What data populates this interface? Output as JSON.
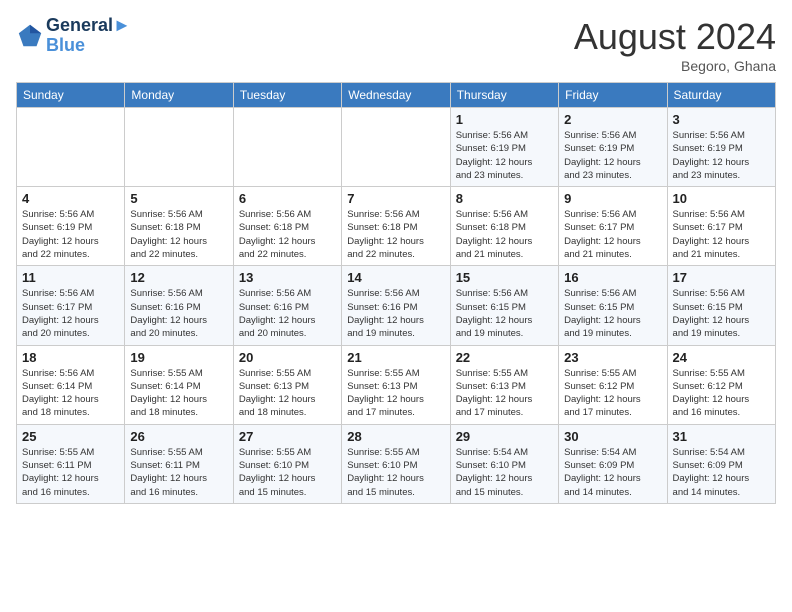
{
  "header": {
    "logo_line1": "General",
    "logo_line2": "Blue",
    "month_year": "August 2024",
    "location": "Begoro, Ghana"
  },
  "days_of_week": [
    "Sunday",
    "Monday",
    "Tuesday",
    "Wednesday",
    "Thursday",
    "Friday",
    "Saturday"
  ],
  "weeks": [
    [
      {
        "day": "",
        "info": ""
      },
      {
        "day": "",
        "info": ""
      },
      {
        "day": "",
        "info": ""
      },
      {
        "day": "",
        "info": ""
      },
      {
        "day": "1",
        "info": "Sunrise: 5:56 AM\nSunset: 6:19 PM\nDaylight: 12 hours\nand 23 minutes."
      },
      {
        "day": "2",
        "info": "Sunrise: 5:56 AM\nSunset: 6:19 PM\nDaylight: 12 hours\nand 23 minutes."
      },
      {
        "day": "3",
        "info": "Sunrise: 5:56 AM\nSunset: 6:19 PM\nDaylight: 12 hours\nand 23 minutes."
      }
    ],
    [
      {
        "day": "4",
        "info": "Sunrise: 5:56 AM\nSunset: 6:19 PM\nDaylight: 12 hours\nand 22 minutes."
      },
      {
        "day": "5",
        "info": "Sunrise: 5:56 AM\nSunset: 6:18 PM\nDaylight: 12 hours\nand 22 minutes."
      },
      {
        "day": "6",
        "info": "Sunrise: 5:56 AM\nSunset: 6:18 PM\nDaylight: 12 hours\nand 22 minutes."
      },
      {
        "day": "7",
        "info": "Sunrise: 5:56 AM\nSunset: 6:18 PM\nDaylight: 12 hours\nand 22 minutes."
      },
      {
        "day": "8",
        "info": "Sunrise: 5:56 AM\nSunset: 6:18 PM\nDaylight: 12 hours\nand 21 minutes."
      },
      {
        "day": "9",
        "info": "Sunrise: 5:56 AM\nSunset: 6:17 PM\nDaylight: 12 hours\nand 21 minutes."
      },
      {
        "day": "10",
        "info": "Sunrise: 5:56 AM\nSunset: 6:17 PM\nDaylight: 12 hours\nand 21 minutes."
      }
    ],
    [
      {
        "day": "11",
        "info": "Sunrise: 5:56 AM\nSunset: 6:17 PM\nDaylight: 12 hours\nand 20 minutes."
      },
      {
        "day": "12",
        "info": "Sunrise: 5:56 AM\nSunset: 6:16 PM\nDaylight: 12 hours\nand 20 minutes."
      },
      {
        "day": "13",
        "info": "Sunrise: 5:56 AM\nSunset: 6:16 PM\nDaylight: 12 hours\nand 20 minutes."
      },
      {
        "day": "14",
        "info": "Sunrise: 5:56 AM\nSunset: 6:16 PM\nDaylight: 12 hours\nand 19 minutes."
      },
      {
        "day": "15",
        "info": "Sunrise: 5:56 AM\nSunset: 6:15 PM\nDaylight: 12 hours\nand 19 minutes."
      },
      {
        "day": "16",
        "info": "Sunrise: 5:56 AM\nSunset: 6:15 PM\nDaylight: 12 hours\nand 19 minutes."
      },
      {
        "day": "17",
        "info": "Sunrise: 5:56 AM\nSunset: 6:15 PM\nDaylight: 12 hours\nand 19 minutes."
      }
    ],
    [
      {
        "day": "18",
        "info": "Sunrise: 5:56 AM\nSunset: 6:14 PM\nDaylight: 12 hours\nand 18 minutes."
      },
      {
        "day": "19",
        "info": "Sunrise: 5:55 AM\nSunset: 6:14 PM\nDaylight: 12 hours\nand 18 minutes."
      },
      {
        "day": "20",
        "info": "Sunrise: 5:55 AM\nSunset: 6:13 PM\nDaylight: 12 hours\nand 18 minutes."
      },
      {
        "day": "21",
        "info": "Sunrise: 5:55 AM\nSunset: 6:13 PM\nDaylight: 12 hours\nand 17 minutes."
      },
      {
        "day": "22",
        "info": "Sunrise: 5:55 AM\nSunset: 6:13 PM\nDaylight: 12 hours\nand 17 minutes."
      },
      {
        "day": "23",
        "info": "Sunrise: 5:55 AM\nSunset: 6:12 PM\nDaylight: 12 hours\nand 17 minutes."
      },
      {
        "day": "24",
        "info": "Sunrise: 5:55 AM\nSunset: 6:12 PM\nDaylight: 12 hours\nand 16 minutes."
      }
    ],
    [
      {
        "day": "25",
        "info": "Sunrise: 5:55 AM\nSunset: 6:11 PM\nDaylight: 12 hours\nand 16 minutes."
      },
      {
        "day": "26",
        "info": "Sunrise: 5:55 AM\nSunset: 6:11 PM\nDaylight: 12 hours\nand 16 minutes."
      },
      {
        "day": "27",
        "info": "Sunrise: 5:55 AM\nSunset: 6:10 PM\nDaylight: 12 hours\nand 15 minutes."
      },
      {
        "day": "28",
        "info": "Sunrise: 5:55 AM\nSunset: 6:10 PM\nDaylight: 12 hours\nand 15 minutes."
      },
      {
        "day": "29",
        "info": "Sunrise: 5:54 AM\nSunset: 6:10 PM\nDaylight: 12 hours\nand 15 minutes."
      },
      {
        "day": "30",
        "info": "Sunrise: 5:54 AM\nSunset: 6:09 PM\nDaylight: 12 hours\nand 14 minutes."
      },
      {
        "day": "31",
        "info": "Sunrise: 5:54 AM\nSunset: 6:09 PM\nDaylight: 12 hours\nand 14 minutes."
      }
    ]
  ]
}
